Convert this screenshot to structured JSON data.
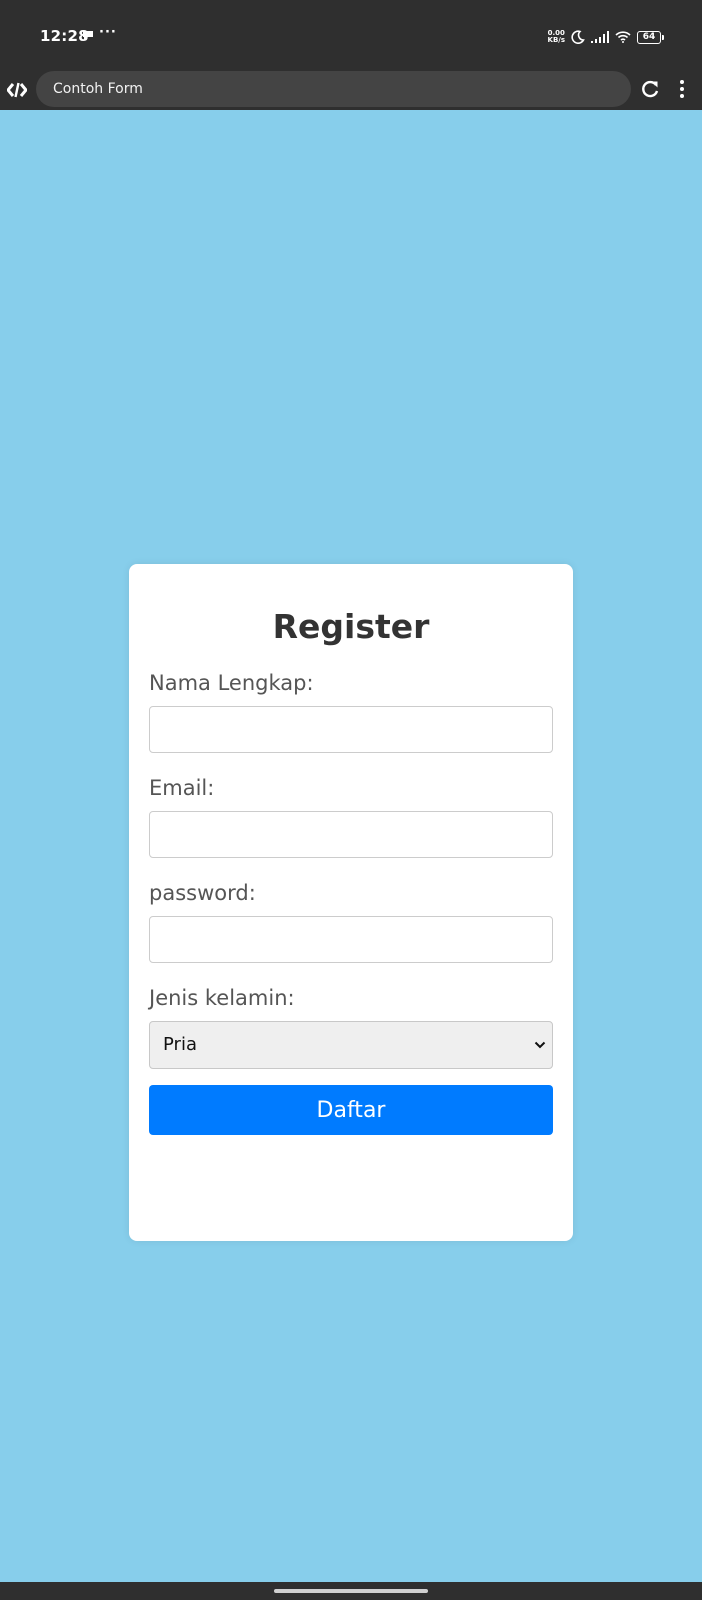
{
  "status_bar": {
    "time": "12:28",
    "overflow_indicator": "···",
    "network_speed_value": "0.00",
    "network_speed_unit": "KB/s",
    "battery_level": "64",
    "icons": [
      "chat-notification-icon",
      "moon-icon",
      "signal-icon",
      "wifi-icon",
      "battery-icon"
    ]
  },
  "browser": {
    "page_title": "Contoh Form",
    "icons": [
      "code-logo-icon",
      "reload-icon",
      "kebab-menu-icon"
    ]
  },
  "form": {
    "title": "Register",
    "fields": [
      {
        "label": "Nama Lengkap:",
        "value": ""
      },
      {
        "label": "Email:",
        "value": ""
      },
      {
        "label": "password:",
        "value": ""
      }
    ],
    "gender": {
      "label": "Jenis kelamin:",
      "selected": "Pria"
    },
    "submit_label": "Daftar"
  },
  "colors": {
    "page_background": "#87ceeb",
    "card_background": "#ffffff",
    "button_background": "#007bff",
    "system_bar": "#2f2f2f"
  }
}
